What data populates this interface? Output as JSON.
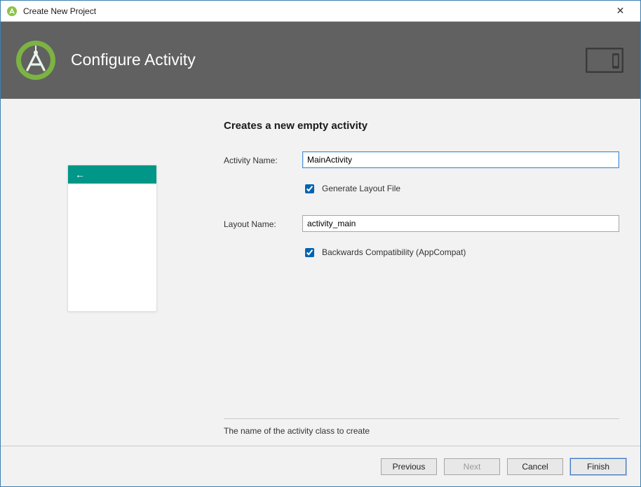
{
  "window": {
    "title": "Create New Project"
  },
  "banner": {
    "title": "Configure Activity"
  },
  "section": {
    "heading": "Creates a new empty activity"
  },
  "form": {
    "activity_name_label": "Activity Name:",
    "activity_name_value": "MainActivity",
    "generate_layout_label": "Generate Layout File",
    "generate_layout_checked": true,
    "layout_name_label": "Layout Name:",
    "layout_name_value": "activity_main",
    "backwards_compat_label": "Backwards Compatibility (AppCompat)",
    "backwards_compat_checked": true
  },
  "hint": {
    "text": "The name of the activity class to create"
  },
  "buttons": {
    "previous": "Previous",
    "next": "Next",
    "cancel": "Cancel",
    "finish": "Finish"
  },
  "icons": {
    "app": "android-studio-icon",
    "close": "✕",
    "back_arrow": "←"
  }
}
